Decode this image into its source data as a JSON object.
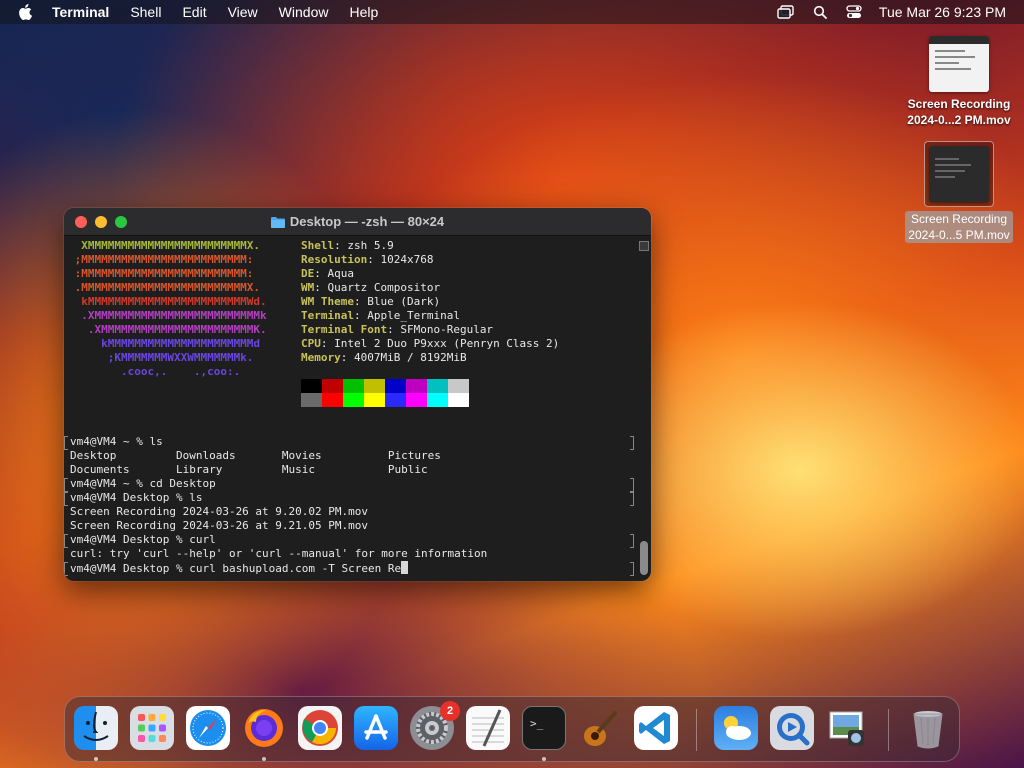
{
  "menubar": {
    "app_name": "Terminal",
    "menus": [
      "Shell",
      "Edit",
      "View",
      "Window",
      "Help"
    ],
    "clock": "Tue Mar 26  9:23 PM",
    "status_icons": [
      "screen-mirroring-icon",
      "spotlight-search-icon",
      "control-center-icon"
    ]
  },
  "desktop_files": [
    {
      "line1": "Screen Recording",
      "line2": "2024-0...2 PM.mov",
      "selected": false
    },
    {
      "line1": "Screen Recording",
      "line2": "2024-0...5 PM.mov",
      "selected": true
    }
  ],
  "terminal": {
    "title": "Desktop — -zsh — 80×24",
    "logo_lines": [
      {
        "text": "  XMMMMMMMMMMMMMMMMMMMMMMMMX.",
        "color": "#a6b83a"
      },
      {
        "text": " ;MMMMMMMMMMMMMMMMMMMMMMMMM:",
        "color": "#d8562e"
      },
      {
        "text": " :MMMMMMMMMMMMMMMMMMMMMMMMM:",
        "color": "#d8562e"
      },
      {
        "text": " .MMMMMMMMMMMMMMMMMMMMMMMMMX.",
        "color": "#d8562e"
      },
      {
        "text": "  kMMMMMMMMMMMMMMMMMMMMMMMMWd.",
        "color": "#d13a2a"
      },
      {
        "text": "  .XMMMMMMMMMMMMMMMMMMMMMMMMMk",
        "color": "#b23fc0"
      },
      {
        "text": "   .XMMMMMMMMMMMMMMMMMMMMMMMK.",
        "color": "#b23fc0"
      },
      {
        "text": "     kMMMMMMMMMMMMMMMMMMMMMMd",
        "color": "#6a45e0"
      },
      {
        "text": "      ;KMMMMMMMWXXWMMMMMMMk.",
        "color": "#6a45e0"
      },
      {
        "text": "        .cooc,.    .,coo:.",
        "color": "#6a45e0"
      }
    ],
    "info": [
      {
        "key": "Shell",
        "value": "zsh 5.9"
      },
      {
        "key": "Resolution",
        "value": "1024x768"
      },
      {
        "key": "DE",
        "value": "Aqua"
      },
      {
        "key": "WM",
        "value": "Quartz Compositor"
      },
      {
        "key": "WM Theme",
        "value": "Blue (Dark)"
      },
      {
        "key": "Terminal",
        "value": "Apple_Terminal"
      },
      {
        "key": "Terminal Font",
        "value": "SFMono-Regular"
      },
      {
        "key": "CPU",
        "value": "Intel 2 Duo P9xxx (Penryn Class 2)"
      },
      {
        "key": "Memory",
        "value": "4007MiB / 8192MiB"
      }
    ],
    "palette_top": [
      "#000000",
      "#c00000",
      "#00c000",
      "#c0c000",
      "#0000c8",
      "#c000c0",
      "#00c0c0",
      "#c8c8c8"
    ],
    "palette_bottom": [
      "#6a6a6a",
      "#ff0000",
      "#00ff00",
      "#ffff00",
      "#2a2aff",
      "#ff00ff",
      "#00ffff",
      "#ffffff"
    ],
    "lines": [
      {
        "text": "vm4@VM4 ~ % ls",
        "prompt": true
      },
      {
        "text": "Desktop         Downloads       Movies          Pictures",
        "prompt": false
      },
      {
        "text": "Documents       Library         Music           Public",
        "prompt": false
      },
      {
        "text": "vm4@VM4 ~ % cd Desktop",
        "prompt": true
      },
      {
        "text": "vm4@VM4 Desktop % ls",
        "prompt": true
      },
      {
        "text": "Screen Recording 2024-03-26 at 9.20.02 PM.mov",
        "prompt": false
      },
      {
        "text": "Screen Recording 2024-03-26 at 9.21.05 PM.mov",
        "prompt": false
      },
      {
        "text": "vm4@VM4 Desktop % curl",
        "prompt": true
      },
      {
        "text": "curl: try 'curl --help' or 'curl --manual' for more information",
        "prompt": false
      },
      {
        "text": "vm4@VM4 Desktop % curl bashupload.com -T Screen Re",
        "prompt": true
      }
    ]
  },
  "dock": {
    "apps": [
      "finder-icon",
      "launchpad-icon",
      "safari-icon",
      "firefox-icon",
      "chrome-icon",
      "app-store-icon",
      "system-settings-icon",
      "textedit-icon",
      "terminal-icon",
      "garageband-icon",
      "vscode-icon",
      "weather-icon",
      "quicktime-icon",
      "preview-icon",
      "trash-icon"
    ],
    "settings_badge": "2"
  }
}
